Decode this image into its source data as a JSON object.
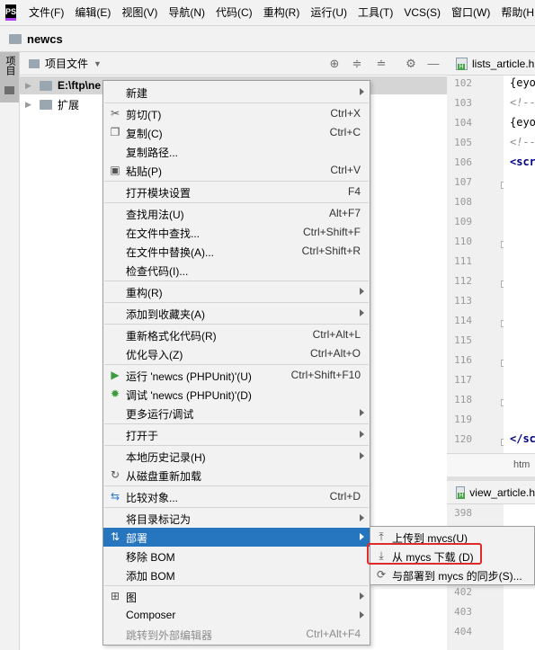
{
  "app": {
    "logo_text": "PS"
  },
  "menubar": [
    "文件(F)",
    "编辑(E)",
    "视图(V)",
    "导航(N)",
    "代码(C)",
    "重构(R)",
    "运行(U)",
    "工具(T)",
    "VCS(S)",
    "窗口(W)",
    "帮助(H"
  ],
  "breadcrumb": "newcs",
  "tool_stripe": {
    "label": "项目"
  },
  "project_panel": {
    "title": "项目文件",
    "tree": [
      {
        "label": "E:\\ftp\\ne"
      },
      {
        "label": "扩展"
      }
    ]
  },
  "editor1": {
    "tab_label": "lists_article.h",
    "line_numbers": [
      "102",
      "103",
      "104",
      "105",
      "106",
      "107",
      "108",
      "109",
      "110",
      "111",
      "112",
      "113",
      "114",
      "115",
      "116",
      "117",
      "118",
      "119",
      "120"
    ],
    "code": [
      {
        "line": "102",
        "text": "{eyo",
        "kind": "normal"
      },
      {
        "line": "103",
        "text": "<!--",
        "kind": "comment"
      },
      {
        "line": "104",
        "text": "{eyo",
        "kind": "normal"
      },
      {
        "line": "105",
        "text": "<!--",
        "kind": "comment"
      },
      {
        "line": "106",
        "text": "<scr",
        "kind": "tag"
      },
      {
        "line": "120",
        "text": "</sc",
        "kind": "tag"
      }
    ],
    "status_text": "htm"
  },
  "editor2": {
    "tab_label": "view_article.h",
    "line_numbers": [
      "398",
      "",
      "",
      "",
      "402",
      "403",
      "404"
    ]
  },
  "context_menu": [
    {
      "label": "新建",
      "shortcut": "",
      "submenu": true,
      "icon": ""
    },
    {
      "sep": true
    },
    {
      "label": "剪切(T)",
      "shortcut": "Ctrl+X",
      "icon": "scissors-icon"
    },
    {
      "label": "复制(C)",
      "shortcut": "Ctrl+C",
      "icon": "copy-icon"
    },
    {
      "label": "复制路径...",
      "shortcut": ""
    },
    {
      "label": "粘贴(P)",
      "shortcut": "Ctrl+V",
      "icon": "paste-icon"
    },
    {
      "sep": true
    },
    {
      "label": "打开模块设置",
      "shortcut": "F4"
    },
    {
      "sep": true
    },
    {
      "label": "查找用法(U)",
      "shortcut": "Alt+F7"
    },
    {
      "label": "在文件中查找...",
      "shortcut": "Ctrl+Shift+F"
    },
    {
      "label": "在文件中替换(A)...",
      "shortcut": "Ctrl+Shift+R"
    },
    {
      "label": "检查代码(I)...",
      "shortcut": ""
    },
    {
      "sep": true
    },
    {
      "label": "重构(R)",
      "submenu": true
    },
    {
      "sep": true
    },
    {
      "label": "添加到收藏夹(A)",
      "submenu": true
    },
    {
      "sep": true
    },
    {
      "label": "重新格式化代码(R)",
      "shortcut": "Ctrl+Alt+L"
    },
    {
      "label": "优化导入(Z)",
      "shortcut": "Ctrl+Alt+O"
    },
    {
      "sep": true
    },
    {
      "label": "运行 'newcs (PHPUnit)'(U)",
      "shortcut": "Ctrl+Shift+F10",
      "icon": "run-icon"
    },
    {
      "label": "调试 'newcs (PHPUnit)'(D)",
      "shortcut": "",
      "icon": "debug-icon"
    },
    {
      "label": "更多运行/调试",
      "submenu": true
    },
    {
      "sep": true
    },
    {
      "label": "打开于",
      "submenu": true
    },
    {
      "sep": true
    },
    {
      "label": "本地历史记录(H)",
      "submenu": true
    },
    {
      "label": "从磁盘重新加载",
      "icon": "reload-icon"
    },
    {
      "sep": true
    },
    {
      "label": "比较对象...",
      "shortcut": "Ctrl+D",
      "icon": "compare-icon"
    },
    {
      "sep": true
    },
    {
      "label": "将目录标记为",
      "submenu": true
    },
    {
      "label": "部署",
      "submenu": true,
      "selected": true,
      "icon": "deploy-icon"
    },
    {
      "label": "移除 BOM"
    },
    {
      "label": "添加 BOM"
    },
    {
      "sep": true
    },
    {
      "label": "图",
      "submenu": true,
      "icon": "diagram-icon"
    },
    {
      "label": "Composer",
      "submenu": true
    },
    {
      "label": "跳转到外部编辑器",
      "shortcut": "Ctrl+Alt+F4",
      "disabled": true
    }
  ],
  "submenu": [
    {
      "label": "上传到 mycs(U)",
      "icon": "upload-icon"
    },
    {
      "label": "从 mycs 下载 (D)",
      "icon": "download-icon",
      "highlighted": true
    },
    {
      "label": "与部署到 mycs 的同步(S)...",
      "icon": "sync-icon"
    }
  ],
  "colors": {
    "selection": "#2675bf",
    "highlight_box": "#e02a2a",
    "run_green": "#3a9c3a"
  }
}
